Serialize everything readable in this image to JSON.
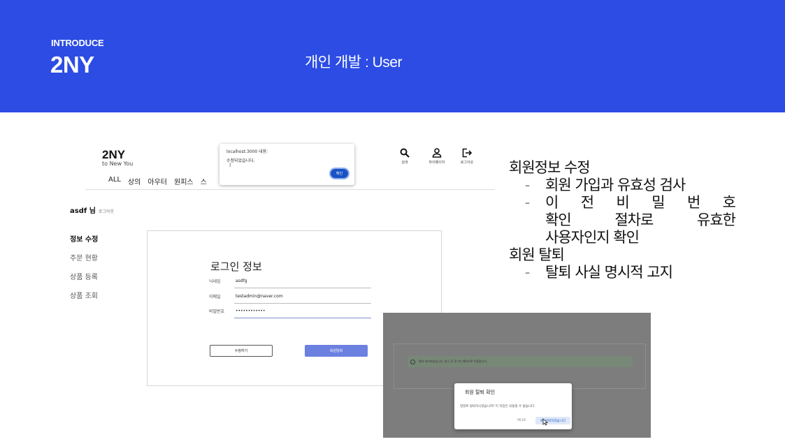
{
  "header": {
    "eyebrow": "INTRODUCE",
    "brand": "2NY",
    "title": "개인 개발 : User",
    "background_color": "#2c4ce4"
  },
  "site": {
    "logo": "2NY",
    "tagline": "to New You",
    "nav": [
      "ALL",
      "상의",
      "아우터",
      "원피스",
      "스"
    ],
    "header_icons": [
      {
        "icon": "search-icon",
        "label": "검색"
      },
      {
        "icon": "user-icon",
        "label": "마이페이지"
      },
      {
        "icon": "logout-icon",
        "label": "로그아웃"
      }
    ],
    "alert": {
      "title": "localhost:3000 내용:",
      "message": "수정되었습니다.",
      "ok_label": "확인"
    },
    "user": {
      "name": "asdf 님",
      "logout_link": "로그아웃"
    },
    "side_menu": [
      {
        "label": "정보 수정",
        "active": true
      },
      {
        "label": "주문 현황",
        "active": false
      },
      {
        "label": "상품 등록",
        "active": false
      },
      {
        "label": "상품 조회",
        "active": false
      }
    ],
    "form": {
      "title": "로그인 정보",
      "nickname_label": "닉네임",
      "nickname_value": "asdfg",
      "email_label": "이메일",
      "email_value": "testadmin@naver.com",
      "password_label": "비밀번호",
      "password_value": "••••••••••••",
      "edit_button": "수정하기",
      "withdraw_button": "회원탈퇴"
    }
  },
  "notes": {
    "section1": "회원정보 수정",
    "section1_items": [
      "회원 가입과 유효성 검사",
      "이 전 비 밀 번 호",
      "확인 절차로 유효한",
      "사용자인지 확인"
    ],
    "section2": "회원 탈퇴",
    "section2_items": [
      "탈퇴 사실 명시적 고지"
    ]
  },
  "modal_screen": {
    "banner_text": "탈퇴 처리되었습니다. 잠시 후 로그인 페이지로 이동합니다.",
    "modal_title": "회원 탈퇴 확인",
    "modal_message": "정말로 탈퇴하시겠습니까? 이 작업은 되돌릴 수 없습니다.",
    "cancel_label": "아니오",
    "confirm_label": "예, 탈퇴하겠습니다"
  }
}
